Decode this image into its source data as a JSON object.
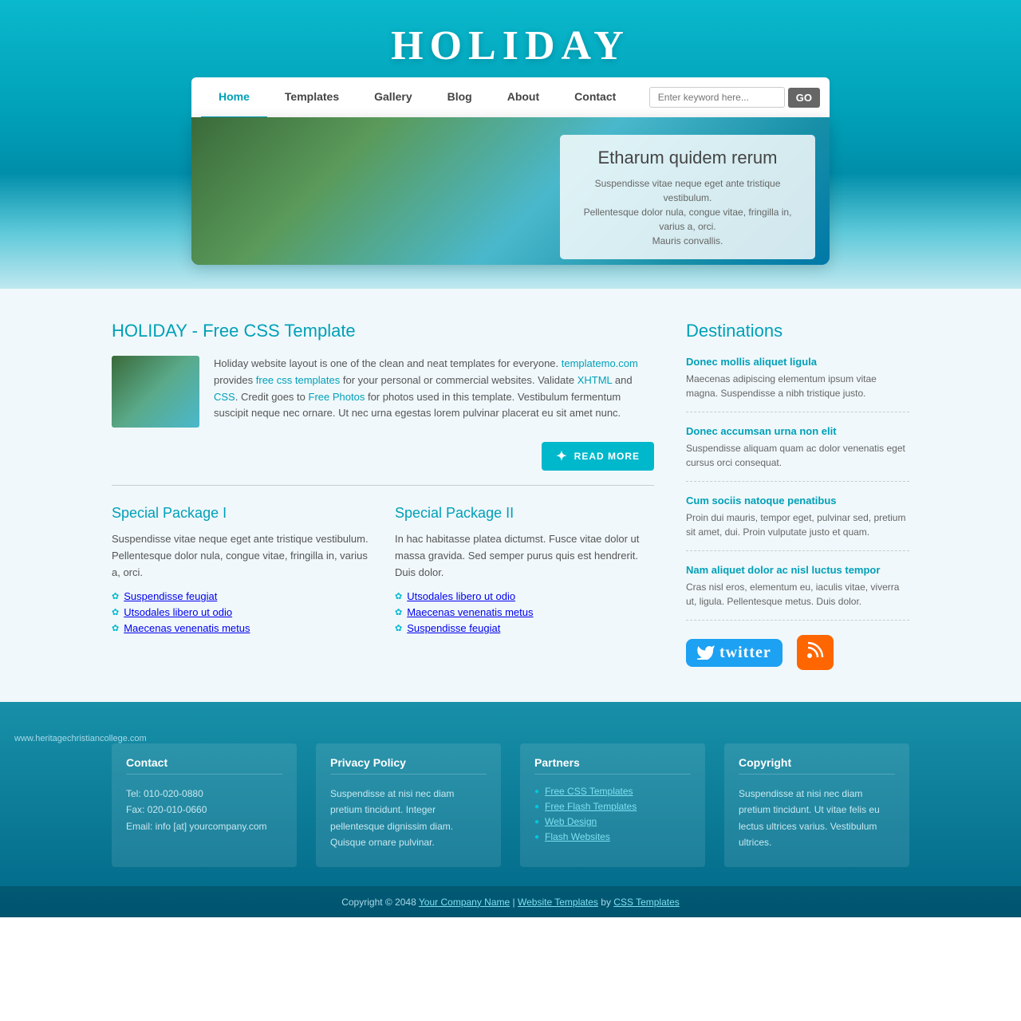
{
  "site": {
    "title": "HOLIDAY",
    "title_reflection": "HOLIDAY"
  },
  "nav": {
    "links": [
      {
        "label": "Home",
        "active": true
      },
      {
        "label": "Templates",
        "active": false
      },
      {
        "label": "Gallery",
        "active": false
      },
      {
        "label": "Blog",
        "active": false
      },
      {
        "label": "About",
        "active": false
      },
      {
        "label": "Contact",
        "active": false
      }
    ],
    "search_placeholder": "Enter keyword here...",
    "search_btn": "GO"
  },
  "hero": {
    "heading": "Etharum quidem rerum",
    "desc": "Suspendisse vitae neque eget ante tristique vestibulum.\nPellentesque dolor nula, congue vitae, fringilla in, varius a, orci.\nMauris convallis."
  },
  "main": {
    "section_title": "HOLIDAY - Free CSS Template",
    "about_text_1": "Holiday website layout is one of the clean and neat templates for everyone.",
    "about_link_1": "templatemo.com",
    "about_text_2": " provides ",
    "about_link_2": "free css templates",
    "about_text_3": " for your personal or commercial websites. Validate ",
    "about_link_3": "XHTML",
    "about_text_4": " and ",
    "about_link_4": "CSS",
    "about_text_5": ". Credit goes to ",
    "about_link_5": "Free Photos",
    "about_text_6": " for photos used in this template. Vestibulum fermentum suscipit neque nec ornare. Ut nec urna egestas lorem pulvinar placerat eu sit amet nunc.",
    "read_more": "READ MORE",
    "packages": [
      {
        "title": "Special Package I",
        "text": "Suspendisse vitae neque eget ante tristique vestibulum. Pellentesque dolor nula, congue vitae, fringilla in, varius a, orci.",
        "items": [
          "Suspendisse feugiat",
          "Utsodales libero ut odio",
          "Maecenas venenatis metus"
        ]
      },
      {
        "title": "Special Package II",
        "text": "In hac habitasse platea dictumst. Fusce vitae dolor ut massa gravida. Sed semper purus quis est hendrerit. Duis dolor.",
        "items": [
          "Utsodales libero ut odio",
          "Maecenas venenatis metus",
          "Suspendisse feugiat"
        ]
      }
    ]
  },
  "destinations": {
    "title": "Destinations",
    "items": [
      {
        "title": "Donec mollis aliquet ligula",
        "text": "Maecenas adipiscing elementum ipsum vitae magna. Suspendisse a nibh tristique justo."
      },
      {
        "title": "Donec accumsan urna non elit",
        "text": "Suspendisse aliquam quam ac dolor venenatis eget cursus orci consequat."
      },
      {
        "title": "Cum sociis natoque penatibus",
        "text": "Proin dui mauris, tempor eget, pulvinar sed, pretium sit amet, dui. Proin vulputate justo et quam."
      },
      {
        "title": "Nam aliquet dolor ac nisl luctus tempor",
        "text": "Cras nisl eros, elementum eu, iaculis vitae, viverra ut, ligula. Pellentesque metus. Duis dolor."
      }
    ]
  },
  "footer": {
    "cols": [
      {
        "title": "Contact",
        "content": "Tel: 010-020-0880\nFax: 020-010-0660\nEmail: info [at] yourcompany.com"
      },
      {
        "title": "Privacy Policy",
        "content": "Suspendisse at nisi nec diam pretium tincidunt. Integer pellentesque dignissim diam. Quisque ornare pulvinar."
      },
      {
        "title": "Partners",
        "links": [
          "Free CSS Templates",
          "Free Flash Templates",
          "Web Design",
          "Flash Websites"
        ]
      },
      {
        "title": "Copyright",
        "content": "Suspendisse at nisi nec diam pretium tincidunt. Ut vitae felis eu lectus ultrices varius. Vestibulum ultrices."
      }
    ],
    "bottom": {
      "text": "Copyright © 2048",
      "company": "Your Company Name",
      "sep1": " | ",
      "link2": "Website Templates",
      "sep2": " by ",
      "link3": "CSS Templates"
    },
    "watermark": "www.heritagechristiancollege.com"
  }
}
